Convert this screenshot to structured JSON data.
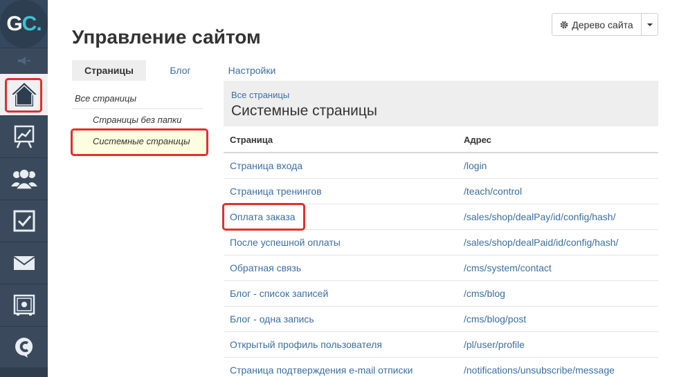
{
  "logo": {
    "text_g": "G",
    "text_c": "C",
    "text_dot": "."
  },
  "sidebar": {
    "items": [
      {
        "name": "home-icon"
      },
      {
        "name": "chart-icon"
      },
      {
        "name": "users-icon"
      },
      {
        "name": "checkbox-icon"
      },
      {
        "name": "mail-icon"
      },
      {
        "name": "safe-icon"
      },
      {
        "name": "chat-c-icon"
      }
    ]
  },
  "header": {
    "title": "Управление сайтом",
    "tree_button": "Дерево сайта"
  },
  "tabs": [
    {
      "label": "Страницы"
    },
    {
      "label": "Блог"
    },
    {
      "label": "Настройки"
    }
  ],
  "left_menu": {
    "all": "Все страницы",
    "no_folder": "Страницы без папки",
    "system": "Системные страницы"
  },
  "content": {
    "breadcrumb": "Все страницы",
    "title": "Системные страницы",
    "columns": [
      "Страница",
      "Адрес"
    ],
    "rows": [
      {
        "page": "Страница входа",
        "address": "/login"
      },
      {
        "page": "Страница тренингов",
        "address": "/teach/control"
      },
      {
        "page": "Оплата заказа",
        "address": "/sales/shop/dealPay/id/config/hash/"
      },
      {
        "page": "После успешной оплаты",
        "address": "/sales/shop/dealPaid/id/config/hash/"
      },
      {
        "page": "Обратная связь",
        "address": "/cms/system/contact"
      },
      {
        "page": "Блог - список записей",
        "address": "/cms/blog"
      },
      {
        "page": "Блог - одна запись",
        "address": "/cms/blog/post"
      },
      {
        "page": "Открытый профиль пользователя",
        "address": "/pl/user/profile"
      },
      {
        "page": "Страница подтверждения e-mail отписки",
        "address": "/notifications/unsubscribe/message"
      }
    ]
  },
  "colors": {
    "link": "#3b6ea5",
    "highlight": "#e0302b",
    "sidebar": "#3a4a5c"
  }
}
